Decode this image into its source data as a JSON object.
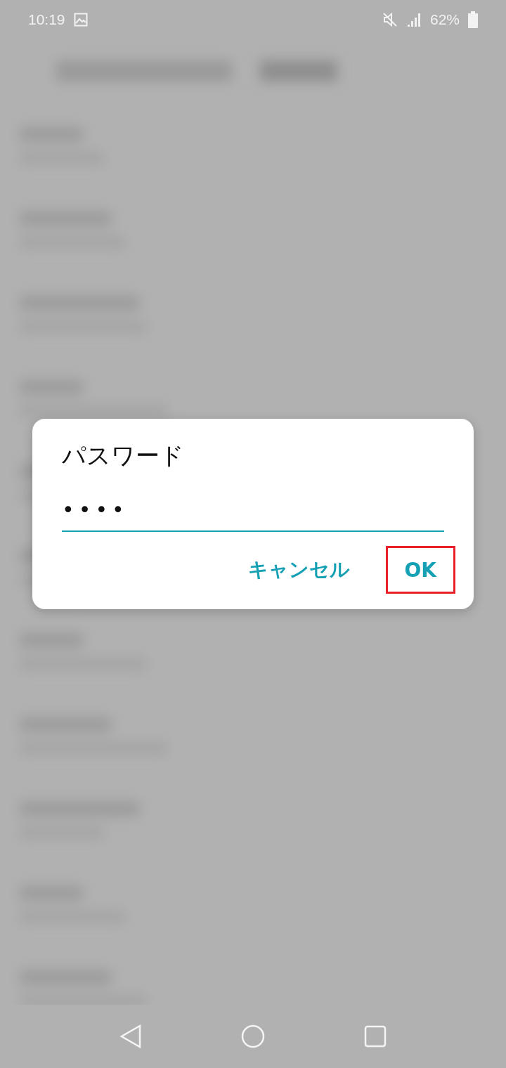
{
  "status_bar": {
    "time": "10:19",
    "battery": "62%"
  },
  "dialog": {
    "title": "パスワード",
    "field": {
      "value": "••••"
    },
    "buttons": [
      {
        "label": "キャンセル",
        "highlighted": false
      },
      {
        "label": "OK",
        "highlighted": true
      }
    ]
  }
}
